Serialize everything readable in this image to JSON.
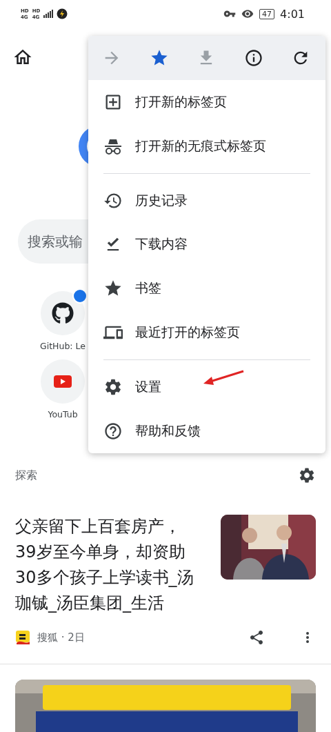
{
  "status_bar": {
    "sims": [
      {
        "hd": "HD",
        "network": "4G"
      },
      {
        "hd": "HD",
        "network": "4G"
      }
    ],
    "battery": "47",
    "time": "4:01"
  },
  "search": {
    "placeholder": "搜索或输"
  },
  "shortcuts": [
    {
      "kind": "github",
      "label": "GitHub: Le",
      "badge": true
    },
    {
      "kind": "youtube",
      "label": "YouTub",
      "badge": false
    }
  ],
  "explore": {
    "title": "探索"
  },
  "article": {
    "title": "父亲留下上百套房产，39岁至今单身，却资助30多个孩子上学读书_汤珈铖_汤臣集团_生活",
    "source": "搜狐 · 2日"
  },
  "menu": {
    "toolbar": [
      {
        "kind": "forward",
        "disabled": true,
        "selected": false
      },
      {
        "kind": "bookmark",
        "disabled": false,
        "selected": true
      },
      {
        "kind": "download",
        "disabled": true,
        "selected": false
      },
      {
        "kind": "info",
        "disabled": false,
        "selected": false
      },
      {
        "kind": "reload",
        "disabled": false,
        "selected": false
      }
    ],
    "groups": [
      [
        {
          "kind": "new-tab",
          "label": "打开新的标签页",
          "pointed": false
        },
        {
          "kind": "incognito",
          "label": "打开新的无痕式标签页",
          "pointed": false
        }
      ],
      [
        {
          "kind": "history",
          "label": "历史记录",
          "pointed": false
        },
        {
          "kind": "downloads",
          "label": "下载内容",
          "pointed": false
        },
        {
          "kind": "bookmarks",
          "label": "书签",
          "pointed": false
        },
        {
          "kind": "recent-tabs",
          "label": "最近打开的标签页",
          "pointed": false
        }
      ],
      [
        {
          "kind": "settings",
          "label": "设置",
          "pointed": true
        },
        {
          "kind": "help",
          "label": "帮助和反馈",
          "pointed": false
        }
      ]
    ]
  }
}
